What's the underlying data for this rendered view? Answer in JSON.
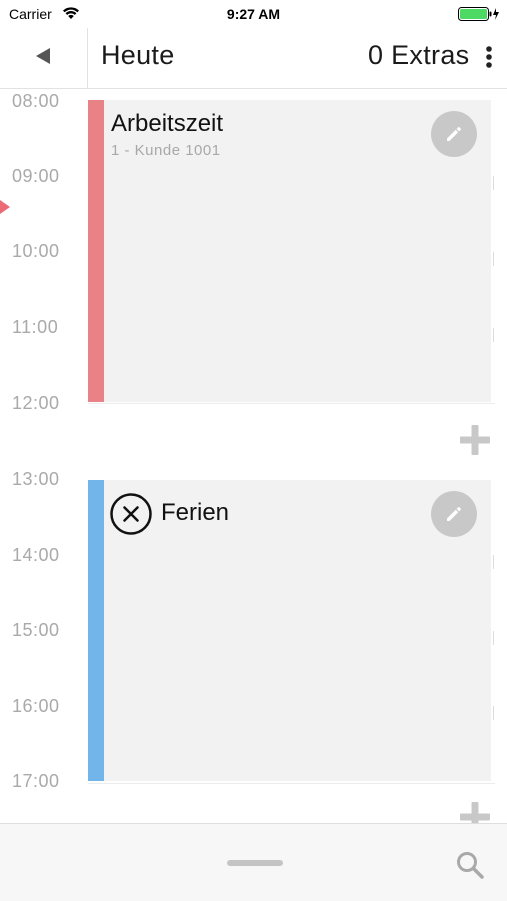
{
  "status_bar": {
    "carrier": "Carrier",
    "time": "9:27 AM",
    "battery_color": "#4cd964"
  },
  "nav": {
    "back_icon": "back-triangle-icon",
    "title": "Heute",
    "extras": "0 Extras",
    "more_icon": "more-vertical-icon"
  },
  "timeline": {
    "hours": [
      "08:00",
      "09:00",
      "10:00",
      "11:00",
      "12:00",
      "13:00",
      "14:00",
      "15:00",
      "16:00",
      "17:00"
    ]
  },
  "events": [
    {
      "title": "Arbeitszeit",
      "subtitle": "1 - Kunde 1001",
      "color": "#e98286",
      "edit_icon": "pencil-icon"
    },
    {
      "title": "Ferien",
      "status_icon": "cancel-circle-icon",
      "color": "#72b5ea",
      "edit_icon": "pencil-icon"
    }
  ],
  "actions": {
    "add_icon": "plus-icon",
    "search_icon": "search-icon",
    "handle_icon": "drag-handle-icon"
  }
}
